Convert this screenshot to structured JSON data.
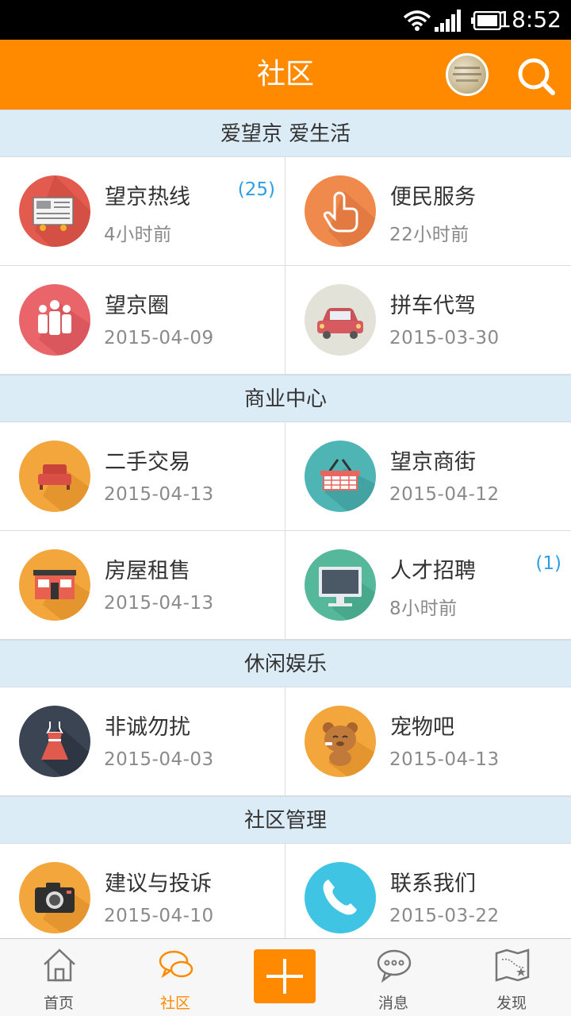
{
  "status_bar": {
    "time": "18:52",
    "icons": [
      "wifi-icon",
      "signal-icon",
      "battery-icon"
    ]
  },
  "app_bar": {
    "title": "社区",
    "avatar_icon": "avatar",
    "search_icon": "search-icon"
  },
  "colors": {
    "accent": "#ff8a00",
    "section_bg": "#dcecf6",
    "badge": "#2c9fe6"
  },
  "sections": [
    {
      "title": "爱望京 爱生活",
      "items": [
        {
          "name": "望京热线",
          "time": "4小时前",
          "badge": "(25)",
          "icon": "newspaper-icon"
        },
        {
          "name": "便民服务",
          "time": "22小时前",
          "badge": "",
          "icon": "hand-tap-icon"
        },
        {
          "name": "望京圈",
          "time": "2015-04-09",
          "badge": "",
          "icon": "people-icon"
        },
        {
          "name": "拼车代驾",
          "time": "2015-03-30",
          "badge": "",
          "icon": "car-icon"
        }
      ]
    },
    {
      "title": "商业中心",
      "items": [
        {
          "name": "二手交易",
          "time": "2015-04-13",
          "badge": "",
          "icon": "sofa-icon"
        },
        {
          "name": "望京商街",
          "time": "2015-04-12",
          "badge": "",
          "icon": "basket-icon"
        },
        {
          "name": "房屋租售",
          "time": "2015-04-13",
          "badge": "",
          "icon": "storefront-icon"
        },
        {
          "name": "人才招聘",
          "time": "8小时前",
          "badge": "(1)",
          "icon": "monitor-icon"
        }
      ]
    },
    {
      "title": "休闲娱乐",
      "items": [
        {
          "name": "非诚勿扰",
          "time": "2015-04-03",
          "badge": "",
          "icon": "dress-icon"
        },
        {
          "name": "宠物吧",
          "time": "2015-04-13",
          "badge": "",
          "icon": "pet-icon"
        }
      ]
    },
    {
      "title": "社区管理",
      "items": [
        {
          "name": "建议与投诉",
          "time": "2015-04-10",
          "badge": "",
          "icon": "camera-icon"
        },
        {
          "name": "联系我们",
          "time": "2015-03-22",
          "badge": "",
          "icon": "phone-icon"
        }
      ]
    }
  ],
  "bottom_nav": {
    "tabs": [
      {
        "label": "首页",
        "icon": "home-icon"
      },
      {
        "label": "社区",
        "icon": "chat-bubbles-icon",
        "active": true
      },
      {
        "label": "",
        "icon": "plus-icon"
      },
      {
        "label": "消息",
        "icon": "message-icon"
      },
      {
        "label": "发现",
        "icon": "map-icon"
      }
    ]
  }
}
